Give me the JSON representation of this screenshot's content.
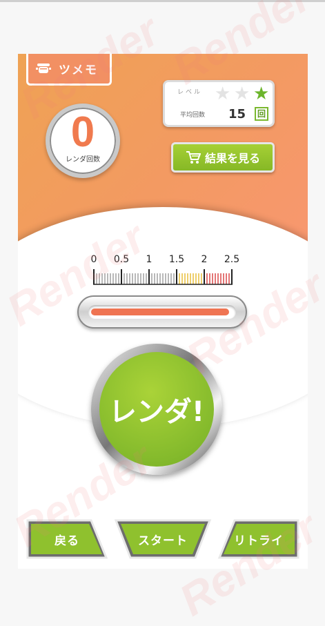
{
  "memo": {
    "label": "ツメモ",
    "icon": "pot-icon"
  },
  "counter": {
    "value": "0",
    "label": "レンダ回数"
  },
  "level": {
    "label": "レベル",
    "stars_total": 3,
    "stars_filled": 1,
    "avg_label": "平均回数",
    "avg_value": "15",
    "avg_unit": "回"
  },
  "result_button": {
    "label": "結果を見る",
    "icon": "cart-icon"
  },
  "gauge": {
    "labels": [
      "0",
      "0.5",
      "1",
      "1.5",
      "2",
      "2.5"
    ],
    "level": 0.97
  },
  "main_button": {
    "label": "レンダ!"
  },
  "nav": {
    "back": "戻る",
    "start": "スタート",
    "retry": "リトライ"
  },
  "watermark": {
    "text": "Render"
  },
  "colors": {
    "accent_orange": "#f29063",
    "accent_green": "#8fc12e",
    "star_on": "#6cb52c",
    "star_off": "#e3e3e3",
    "tick_yellow": "#e6b82a",
    "tick_red": "#d93a3a"
  }
}
